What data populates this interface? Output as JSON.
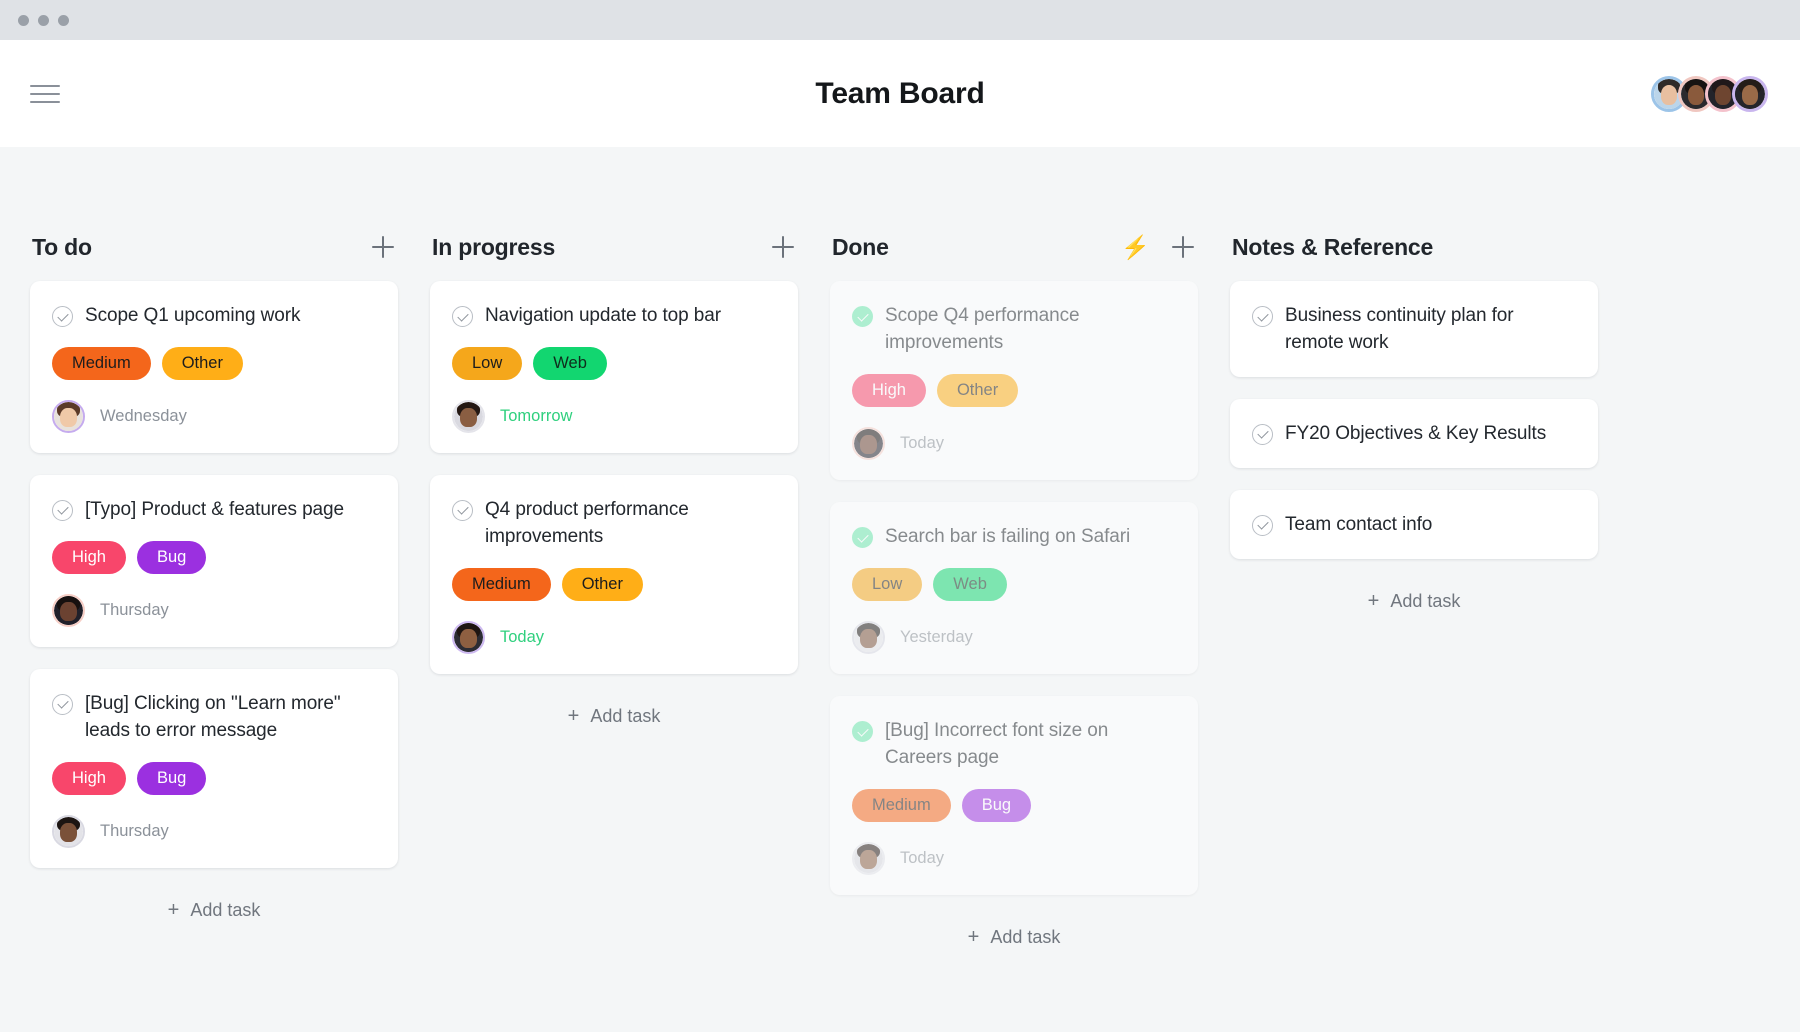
{
  "window": {
    "dots": 3
  },
  "header": {
    "menu_icon": "hamburger-icon",
    "title": "Team Board",
    "avatars": [
      {
        "name": "avatar-1",
        "ring": "#9CC4E8",
        "hair": "#2E2A28",
        "skin": "#E8BFA0",
        "body": "#BBD5EA"
      },
      {
        "name": "avatar-2",
        "ring": "#F0C7C0",
        "hair": "#171312",
        "skin": "#8A5A3C",
        "body": "#2A2A2E"
      },
      {
        "name": "avatar-3",
        "ring": "#F4C2CC",
        "hair": "#20181A",
        "skin": "#6E4530",
        "body": "#23232A"
      },
      {
        "name": "avatar-4",
        "ring": "#C9B6EE",
        "hair": "#241C18",
        "skin": "#9A6A48",
        "body": "#25252B"
      }
    ]
  },
  "columns": [
    {
      "title": "To do",
      "bolt": false,
      "add_label": "Add task",
      "faded": false,
      "cards": [
        {
          "title": "Scope Q1 upcoming work",
          "done": false,
          "tags": [
            {
              "label": "Medium",
              "bg": "#F4661B",
              "fg": "#1d1d1d"
            },
            {
              "label": "Other",
              "bg": "#FFAE17",
              "fg": "#1d1d1d"
            }
          ],
          "date": "Wednesday",
          "date_soon": false,
          "avatar": {
            "ring": "#C5ABEE",
            "hair": "#5B3A28",
            "skin": "#F0C9A8",
            "body": "#E8E2DC"
          }
        },
        {
          "title": "[Typo] Product & features page",
          "done": false,
          "tags": [
            {
              "label": "High",
              "bg": "#F8466B",
              "fg": "#ffffff"
            },
            {
              "label": "Bug",
              "bg": "#9B30E0",
              "fg": "#ffffff"
            }
          ],
          "date": "Thursday",
          "date_soon": false,
          "avatar": {
            "ring": "#F6CEC6",
            "hair": "#16100F",
            "skin": "#6B4231",
            "body": "#20202A"
          }
        },
        {
          "title": "[Bug] Clicking on \"Learn more\" leads to error message",
          "done": false,
          "tags": [
            {
              "label": "High",
              "bg": "#F8466B",
              "fg": "#ffffff"
            },
            {
              "label": "Bug",
              "bg": "#9B30E0",
              "fg": "#ffffff"
            }
          ],
          "date": "Thursday",
          "date_soon": false,
          "avatar": {
            "ring": "#D9D9E2",
            "hair": "#1C1512",
            "skin": "#7A5139",
            "body": "#E3E3E8"
          }
        }
      ]
    },
    {
      "title": "In progress",
      "bolt": false,
      "add_label": "Add task",
      "faded": false,
      "cards": [
        {
          "title": "Navigation update to top bar",
          "done": false,
          "tags": [
            {
              "label": "Low",
              "bg": "#F5A71B",
              "fg": "#1d1d1d"
            },
            {
              "label": "Web",
              "bg": "#12D670",
              "fg": "#0f2c1c"
            }
          ],
          "date": "Tomorrow",
          "date_soon": true,
          "avatar": {
            "ring": "#E4E4EA",
            "hair": "#241813",
            "skin": "#8A5E42",
            "body": "#D9D9E0"
          }
        },
        {
          "title": "Q4 product performance improvements",
          "done": false,
          "tags": [
            {
              "label": "Medium",
              "bg": "#F4661B",
              "fg": "#1d1d1d"
            },
            {
              "label": "Other",
              "bg": "#FFAE17",
              "fg": "#1d1d1d"
            }
          ],
          "date": "Today",
          "date_soon": true,
          "avatar": {
            "ring": "#CDB9F0",
            "hair": "#1E1512",
            "skin": "#8E5F41",
            "body": "#2C2C34"
          }
        }
      ]
    },
    {
      "title": "Done",
      "bolt": true,
      "bolt_icon": "lightning-bolt-icon",
      "add_label": "Add task",
      "faded": true,
      "cards": [
        {
          "title": "Scope Q4 performance improvements",
          "done": true,
          "tags": [
            {
              "label": "High",
              "bg": "#F8466B",
              "fg": "#ffffff"
            },
            {
              "label": "Other",
              "bg": "#FFAE17",
              "fg": "#1d1d1d"
            }
          ],
          "date": "Today",
          "date_soon": false,
          "avatar": {
            "ring": "#F6CEC6",
            "hair": "#16100F",
            "skin": "#6B4231",
            "body": "#20202A"
          }
        },
        {
          "title": "Search bar is failing on Safari",
          "done": true,
          "tags": [
            {
              "label": "Low",
              "bg": "#F5A71B",
              "fg": "#1d1d1d"
            },
            {
              "label": "Web",
              "bg": "#12D670",
              "fg": "#0f2c1c"
            }
          ],
          "date": "Yesterday",
          "date_soon": false,
          "avatar": {
            "ring": "#D9D9E2",
            "hair": "#1C1512",
            "skin": "#7A5139",
            "body": "#E3E3E8"
          }
        },
        {
          "title": "[Bug] Incorrect font size on Careers page",
          "done": true,
          "tags": [
            {
              "label": "Medium",
              "bg": "#F4661B",
              "fg": "#1d1d1d"
            },
            {
              "label": "Bug",
              "bg": "#9B30E0",
              "fg": "#ffffff"
            }
          ],
          "date": "Today",
          "date_soon": false,
          "avatar": {
            "ring": "#E4E4EA",
            "hair": "#241813",
            "skin": "#8A5E42",
            "body": "#D9D9E0"
          }
        }
      ]
    },
    {
      "title": "Notes & Reference",
      "bolt": false,
      "add_label": "Add task",
      "faded": false,
      "cards": [
        {
          "title": "Business continuity plan for remote work",
          "done": false,
          "tags": [],
          "date": "",
          "date_soon": false,
          "avatar": null
        },
        {
          "title": "FY20 Objectives & Key Results",
          "done": false,
          "tags": [],
          "date": "",
          "date_soon": false,
          "avatar": null
        },
        {
          "title": "Team contact info",
          "done": false,
          "tags": [],
          "date": "",
          "date_soon": false,
          "avatar": null
        }
      ]
    }
  ]
}
